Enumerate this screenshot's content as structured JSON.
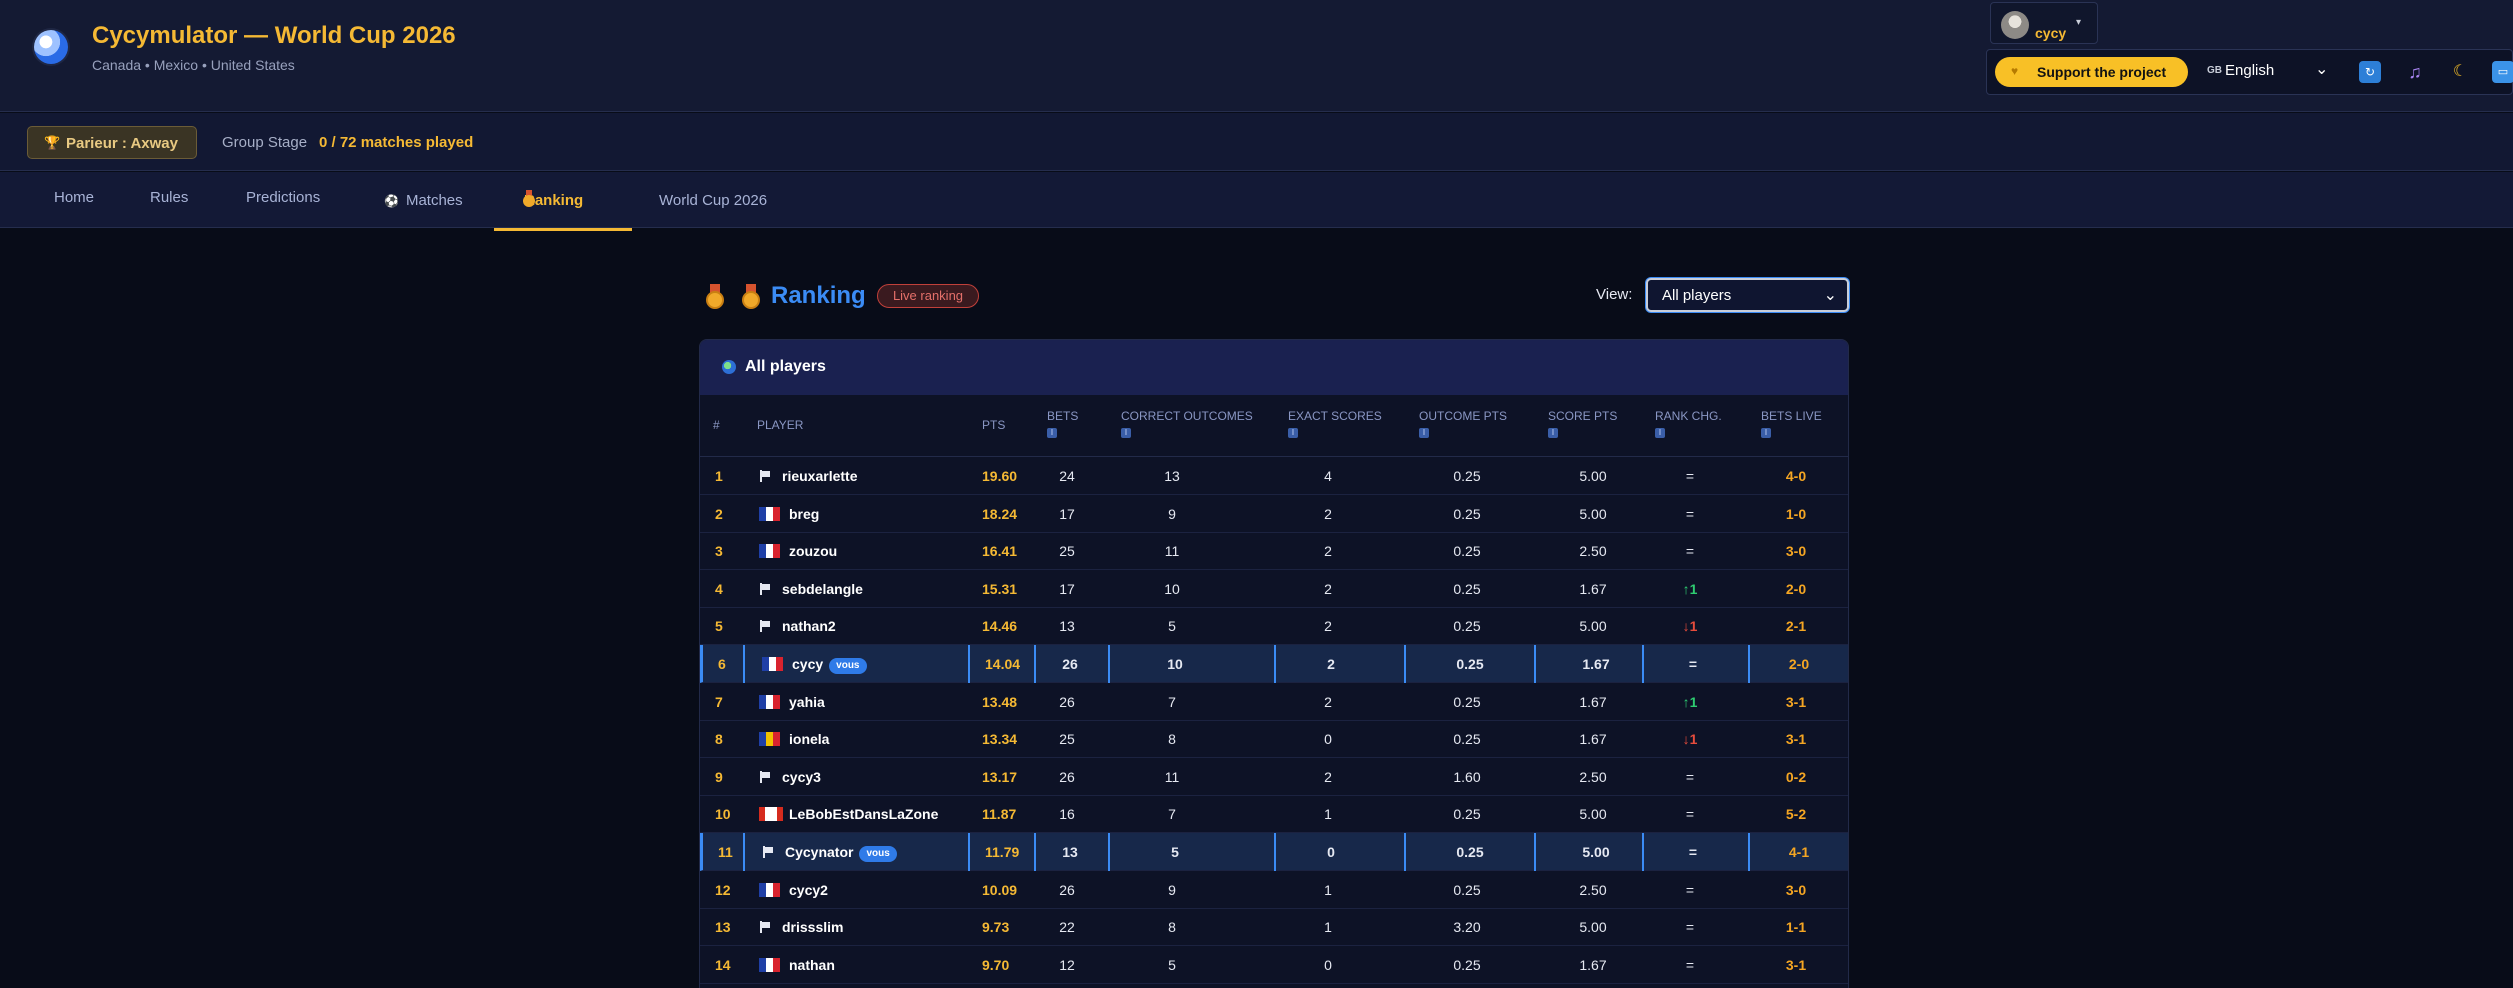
{
  "header": {
    "title": "Cycymulator — World Cup 2026",
    "subtitle": "Canada • Mexico • United States",
    "user": {
      "name": "cycy"
    },
    "support_label": "Support the project",
    "language": "English"
  },
  "subbar": {
    "bettor": "Parieur : Axway",
    "stage": "Group Stage",
    "matches_played": "0 / 72 matches played"
  },
  "nav": {
    "home": "Home",
    "rules": "Rules",
    "predictions": "Predictions",
    "matches": "Matches",
    "ranking": "Ranking",
    "world_cup": "World Cup 2026",
    "active": "ranking"
  },
  "ranking": {
    "title": "Ranking",
    "live_badge": "Live ranking",
    "view_label": "View:",
    "view_value": "All players",
    "table_title": "All players",
    "you_badge": "vous",
    "columns": {
      "rank": "#",
      "player": "Player",
      "pts": "Pts",
      "bets": "Bets",
      "correct": "Correct outcomes",
      "exact": "Exact scores",
      "outcome_pts": "Outcome pts",
      "score_pts": "Score pts",
      "rank_chg": "Rank chg.",
      "bets_live": "Bets live"
    },
    "rows": [
      {
        "rank": "1",
        "flag": "white",
        "name": "rieuxarlette",
        "pts": "19.60",
        "bets": "24",
        "correct": "13",
        "exact": "4",
        "opts": "0.25",
        "spts": "5.00",
        "chg": "=",
        "chg_dir": "same",
        "live": "4-0",
        "me": false
      },
      {
        "rank": "2",
        "flag": "fr",
        "name": "breg",
        "pts": "18.24",
        "bets": "17",
        "correct": "9",
        "exact": "2",
        "opts": "0.25",
        "spts": "5.00",
        "chg": "=",
        "chg_dir": "same",
        "live": "1-0",
        "me": false
      },
      {
        "rank": "3",
        "flag": "fr",
        "name": "zouzou",
        "pts": "16.41",
        "bets": "25",
        "correct": "11",
        "exact": "2",
        "opts": "0.25",
        "spts": "2.50",
        "chg": "=",
        "chg_dir": "same",
        "live": "3-0",
        "me": false
      },
      {
        "rank": "4",
        "flag": "white",
        "name": "sebdelangle",
        "pts": "15.31",
        "bets": "17",
        "correct": "10",
        "exact": "2",
        "opts": "0.25",
        "spts": "1.67",
        "chg": "↑1",
        "chg_dir": "up",
        "live": "2-0",
        "me": false
      },
      {
        "rank": "5",
        "flag": "white",
        "name": "nathan2",
        "pts": "14.46",
        "bets": "13",
        "correct": "5",
        "exact": "2",
        "opts": "0.25",
        "spts": "5.00",
        "chg": "↓1",
        "chg_dir": "down",
        "live": "2-1",
        "me": false
      },
      {
        "rank": "6",
        "flag": "fr",
        "name": "cycy",
        "pts": "14.04",
        "bets": "26",
        "correct": "10",
        "exact": "2",
        "opts": "0.25",
        "spts": "1.67",
        "chg": "=",
        "chg_dir": "same",
        "live": "2-0",
        "me": true
      },
      {
        "rank": "7",
        "flag": "fr",
        "name": "yahia",
        "pts": "13.48",
        "bets": "26",
        "correct": "7",
        "exact": "2",
        "opts": "0.25",
        "spts": "1.67",
        "chg": "↑1",
        "chg_dir": "up",
        "live": "3-1",
        "me": false
      },
      {
        "rank": "8",
        "flag": "ro",
        "name": "ionela",
        "pts": "13.34",
        "bets": "25",
        "correct": "8",
        "exact": "0",
        "opts": "0.25",
        "spts": "1.67",
        "chg": "↓1",
        "chg_dir": "down",
        "live": "3-1",
        "me": false
      },
      {
        "rank": "9",
        "flag": "white",
        "name": "cycy3",
        "pts": "13.17",
        "bets": "26",
        "correct": "11",
        "exact": "2",
        "opts": "1.60",
        "spts": "2.50",
        "chg": "=",
        "chg_dir": "same",
        "live": "0-2",
        "me": false
      },
      {
        "rank": "10",
        "flag": "ca",
        "name": "LeBobEstDansLaZone",
        "pts": "11.87",
        "bets": "16",
        "correct": "7",
        "exact": "1",
        "opts": "0.25",
        "spts": "5.00",
        "chg": "=",
        "chg_dir": "same",
        "live": "5-2",
        "me": false
      },
      {
        "rank": "11",
        "flag": "white",
        "name": "Cycynator",
        "pts": "11.79",
        "bets": "13",
        "correct": "5",
        "exact": "0",
        "opts": "0.25",
        "spts": "5.00",
        "chg": "=",
        "chg_dir": "same",
        "live": "4-1",
        "me": true
      },
      {
        "rank": "12",
        "flag": "fr",
        "name": "cycy2",
        "pts": "10.09",
        "bets": "26",
        "correct": "9",
        "exact": "1",
        "opts": "0.25",
        "spts": "2.50",
        "chg": "=",
        "chg_dir": "same",
        "live": "3-0",
        "me": false
      },
      {
        "rank": "13",
        "flag": "white",
        "name": "drissslim",
        "pts": "9.73",
        "bets": "22",
        "correct": "8",
        "exact": "1",
        "opts": "3.20",
        "spts": "5.00",
        "chg": "=",
        "chg_dir": "same",
        "live": "1-1",
        "me": false
      },
      {
        "rank": "14",
        "flag": "fr",
        "name": "nathan",
        "pts": "9.70",
        "bets": "12",
        "correct": "5",
        "exact": "0",
        "opts": "0.25",
        "spts": "1.67",
        "chg": "=",
        "chg_dir": "same",
        "live": "3-1",
        "me": false
      }
    ]
  }
}
